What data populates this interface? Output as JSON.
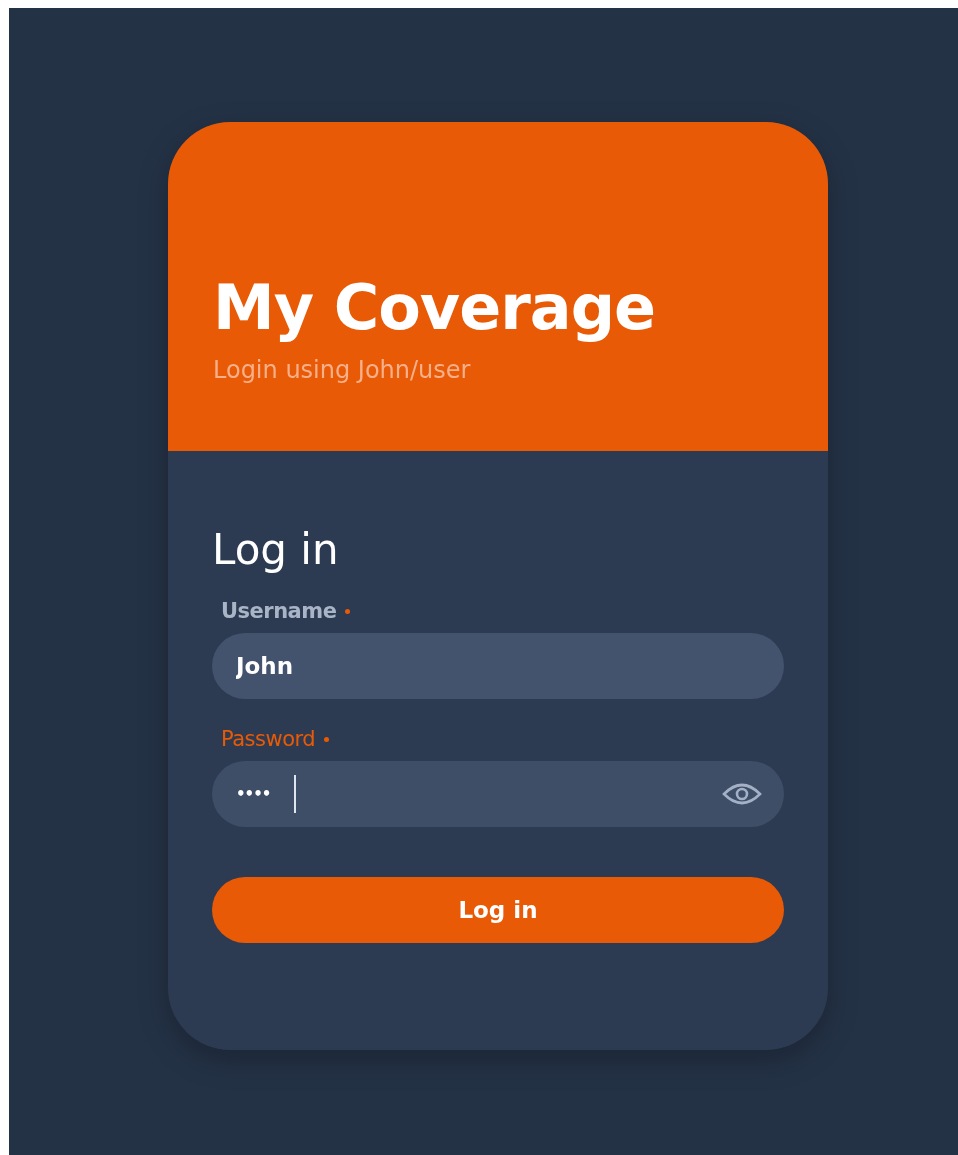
{
  "header": {
    "title": "My Coverage",
    "subtitle": "Login using John/user"
  },
  "form": {
    "heading": "Log in",
    "fields": [
      {
        "label": "Username",
        "required": true,
        "value": "John",
        "focused": false,
        "kind": "text"
      },
      {
        "label": "Password",
        "required": true,
        "value": "••••",
        "focused": true,
        "kind": "password"
      }
    ],
    "submit": "Log in"
  }
}
